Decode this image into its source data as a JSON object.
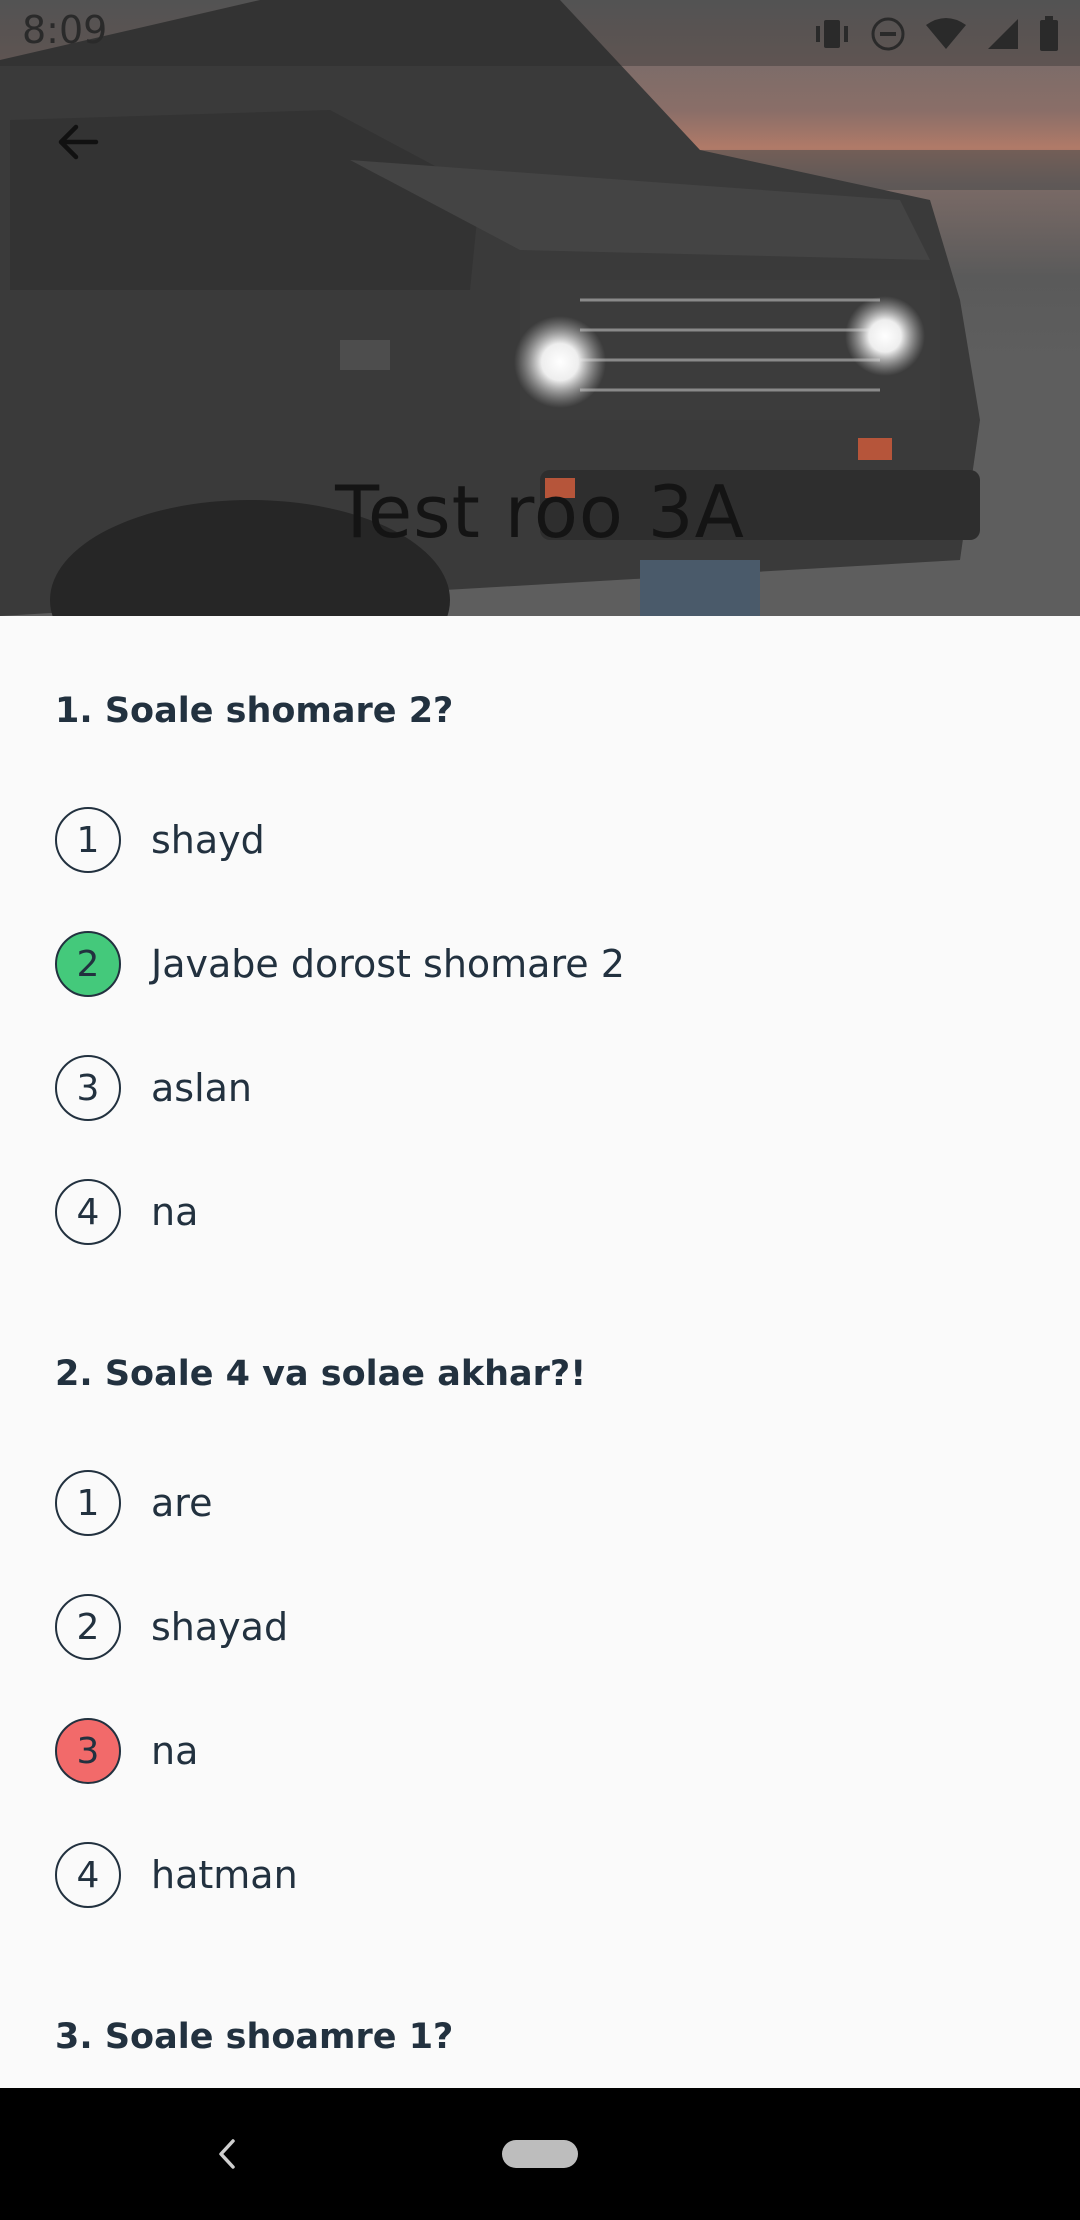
{
  "status_bar": {
    "time": "8:09"
  },
  "header": {
    "title": "Test roo 3A"
  },
  "questions": [
    {
      "title": "1. Soale shomare 2?",
      "options": [
        {
          "number": "1",
          "text": "shayd",
          "state": "none"
        },
        {
          "number": "2",
          "text": "Javabe dorost shomare 2",
          "state": "correct"
        },
        {
          "number": "3",
          "text": "aslan",
          "state": "none"
        },
        {
          "number": "4",
          "text": "na",
          "state": "none"
        }
      ]
    },
    {
      "title": "2. Soale 4 va solae akhar?!",
      "options": [
        {
          "number": "1",
          "text": "are",
          "state": "none"
        },
        {
          "number": "2",
          "text": "shayad",
          "state": "none"
        },
        {
          "number": "3",
          "text": "na",
          "state": "wrong"
        },
        {
          "number": "4",
          "text": "hatman",
          "state": "none"
        }
      ]
    },
    {
      "title": "3. Soale shoamre 1?",
      "options": []
    }
  ],
  "colors": {
    "correct": "#44c97b",
    "wrong": "#f26a6a",
    "text": "#22313f"
  }
}
